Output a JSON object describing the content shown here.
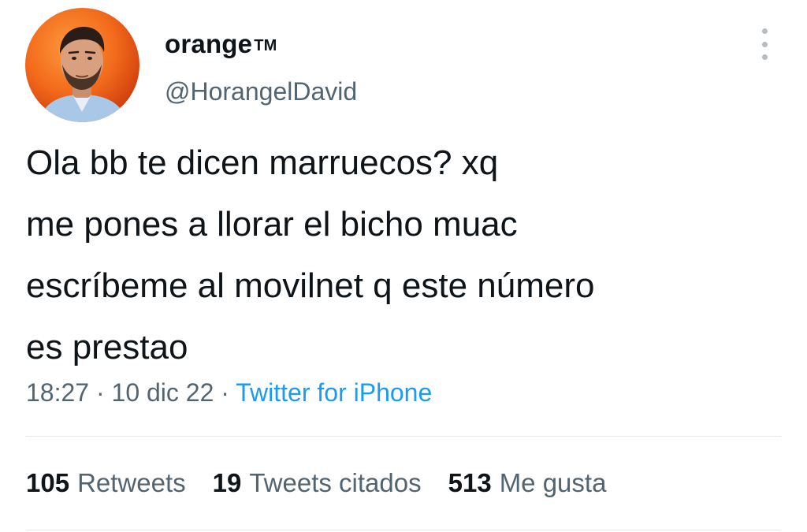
{
  "user": {
    "display_name": "orange",
    "display_suffix": "TM",
    "handle": "@HorangelDavid"
  },
  "tweet": {
    "text": "Ola bb te dicen marruecos? xq\nme pones a llorar el bicho muac\nescríbeme al movilnet q este número\nes prestao",
    "time": "18:27",
    "separator": "·",
    "date": "10 dic 22",
    "source": "Twitter for iPhone"
  },
  "stats": {
    "retweets": {
      "count": "105",
      "label": "Retweets"
    },
    "quotes": {
      "count": "19",
      "label": "Tweets citados"
    },
    "likes": {
      "count": "513",
      "label": "Me gusta"
    }
  },
  "icons": {
    "more": "more-vertical-icon"
  },
  "colors": {
    "text": "#0f1419",
    "secondary": "#536471",
    "link": "#1d9bf0",
    "avatar_bg": "#f26a1b"
  }
}
